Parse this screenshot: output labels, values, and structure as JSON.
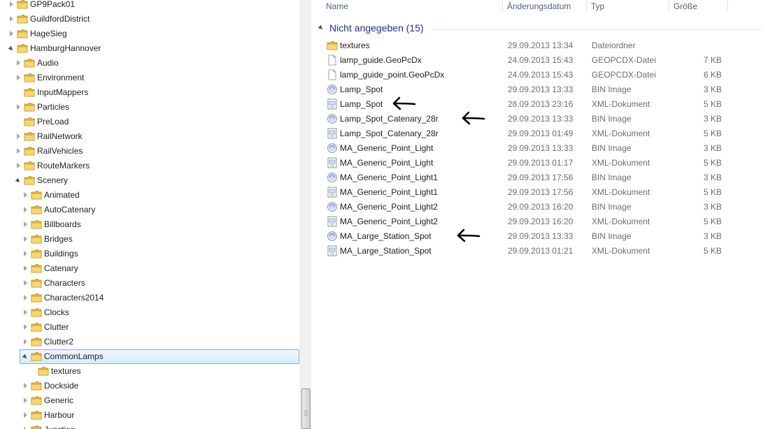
{
  "tree": {
    "items": [
      {
        "label": "GP9Pack01",
        "level": 0,
        "state": "closed"
      },
      {
        "label": "GuildfordDistrict",
        "level": 0,
        "state": "closed"
      },
      {
        "label": "HageSieg",
        "level": 0,
        "state": "closed"
      },
      {
        "label": "HamburgHannover",
        "level": 0,
        "state": "open"
      },
      {
        "label": "Audio",
        "level": 1,
        "state": "closed"
      },
      {
        "label": "Environment",
        "level": 1,
        "state": "closed"
      },
      {
        "label": "InputMappers",
        "level": 1,
        "state": "none"
      },
      {
        "label": "Particles",
        "level": 1,
        "state": "closed"
      },
      {
        "label": "PreLoad",
        "level": 1,
        "state": "none"
      },
      {
        "label": "RailNetwork",
        "level": 1,
        "state": "closed"
      },
      {
        "label": "RailVehicles",
        "level": 1,
        "state": "closed"
      },
      {
        "label": "RouteMarkers",
        "level": 1,
        "state": "closed"
      },
      {
        "label": "Scenery",
        "level": 1,
        "state": "open"
      },
      {
        "label": "Animated",
        "level": 2,
        "state": "closed"
      },
      {
        "label": "AutoCatenary",
        "level": 2,
        "state": "closed"
      },
      {
        "label": "Billboards",
        "level": 2,
        "state": "closed"
      },
      {
        "label": "Bridges",
        "level": 2,
        "state": "closed"
      },
      {
        "label": "Buildings",
        "level": 2,
        "state": "closed"
      },
      {
        "label": "Catenary",
        "level": 2,
        "state": "closed"
      },
      {
        "label": "Characters",
        "level": 2,
        "state": "closed"
      },
      {
        "label": "Characters2014",
        "level": 2,
        "state": "closed"
      },
      {
        "label": "Clocks",
        "level": 2,
        "state": "closed"
      },
      {
        "label": "Clutter",
        "level": 2,
        "state": "closed"
      },
      {
        "label": "Clutter2",
        "level": 2,
        "state": "closed"
      },
      {
        "label": "CommonLamps",
        "level": 2,
        "state": "open",
        "selected": true
      },
      {
        "label": "textures",
        "level": 3,
        "state": "none"
      },
      {
        "label": "Dockside",
        "level": 2,
        "state": "closed"
      },
      {
        "label": "Generic",
        "level": 2,
        "state": "closed"
      },
      {
        "label": "Harbour",
        "level": 2,
        "state": "closed"
      },
      {
        "label": "Junction",
        "level": 2,
        "state": "closed"
      }
    ]
  },
  "columns": {
    "name": "Name",
    "date": "Änderungsdatum",
    "type": "Typ",
    "size": "Größe"
  },
  "group": {
    "label": "Nicht angegeben (15)"
  },
  "files": [
    {
      "name": "textures",
      "date": "29.09.2013 13:34",
      "type": "Dateiordner",
      "size": "",
      "icon": "folder-icon"
    },
    {
      "name": "lamp_guide.GeoPcDx",
      "date": "24.09.2013 15:43",
      "type": "GEOPCDX-Datei",
      "size": "7 KB",
      "icon": "file-icon"
    },
    {
      "name": "lamp_guide_point.GeoPcDx",
      "date": "24.09.2013 15:43",
      "type": "GEOPCDX-Datei",
      "size": "6 KB",
      "icon": "file-icon"
    },
    {
      "name": "Lamp_Spot",
      "date": "29.09.2013 13:33",
      "type": "BIN Image",
      "size": "3 KB",
      "icon": "bin-icon"
    },
    {
      "name": "Lamp_Spot",
      "date": "28.09.2013 23:16",
      "type": "XML-Dokument",
      "size": "5 KB",
      "icon": "xml-icon"
    },
    {
      "name": "Lamp_Spot_Catenary_28r",
      "date": "29.09.2013 13:33",
      "type": "BIN Image",
      "size": "3 KB",
      "icon": "bin-icon"
    },
    {
      "name": "Lamp_Spot_Catenary_28r",
      "date": "29.09.2013 01:49",
      "type": "XML-Dokument",
      "size": "5 KB",
      "icon": "xml-icon"
    },
    {
      "name": "MA_Generic_Point_Light",
      "date": "29.09.2013 13:33",
      "type": "BIN Image",
      "size": "3 KB",
      "icon": "bin-icon"
    },
    {
      "name": "MA_Generic_Point_Light",
      "date": "29.09.2013 01:17",
      "type": "XML-Dokument",
      "size": "5 KB",
      "icon": "xml-icon"
    },
    {
      "name": "MA_Generic_Point_Light1",
      "date": "29.09.2013 17:56",
      "type": "BIN Image",
      "size": "3 KB",
      "icon": "bin-icon"
    },
    {
      "name": "MA_Generic_Point_Light1",
      "date": "29.09.2013 17:56",
      "type": "XML-Dokument",
      "size": "5 KB",
      "icon": "xml-icon"
    },
    {
      "name": "MA_Generic_Point_Light2",
      "date": "29.09.2013 16:20",
      "type": "BIN Image",
      "size": "3 KB",
      "icon": "bin-icon"
    },
    {
      "name": "MA_Generic_Point_Light2",
      "date": "29.09.2013 16:20",
      "type": "XML-Dokument",
      "size": "5 KB",
      "icon": "xml-icon"
    },
    {
      "name": "MA_Large_Station_Spot",
      "date": "29.09.2013 13:33",
      "type": "BIN Image",
      "size": "3 KB",
      "icon": "bin-icon"
    },
    {
      "name": "MA_Large_Station_Spot",
      "date": "29.09.2013 01:21",
      "type": "XML-Dokument",
      "size": "5 KB",
      "icon": "xml-icon"
    }
  ],
  "annotations": {
    "arrow_marked_rows": [
      4,
      5,
      13
    ],
    "arrow_color": "#000000"
  }
}
